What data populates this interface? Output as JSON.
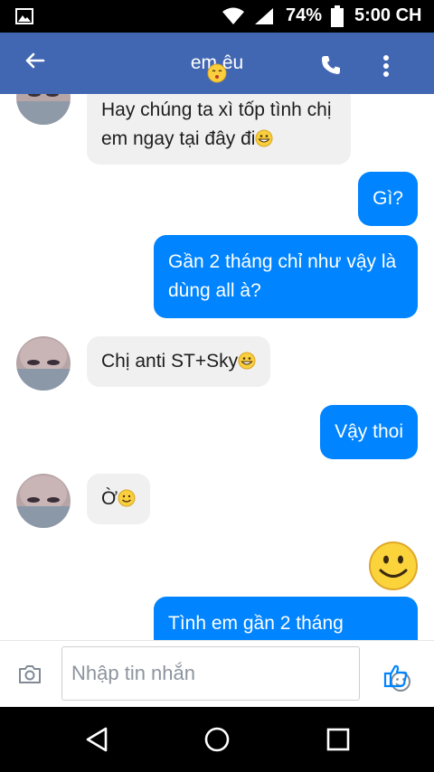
{
  "status_bar": {
    "battery_percent": "74%",
    "time": "5:00 CH"
  },
  "header": {
    "title": "em êu",
    "title_emoji": "kissing-face-icon"
  },
  "messages": [
    {
      "side": "in",
      "text": "Hay chúng ta xì tốp tình chị em ngay tại đây đi",
      "emoji": "grinning-face-icon"
    },
    {
      "side": "out",
      "text": "Gì?"
    },
    {
      "side": "out",
      "text": "Gần 2 tháng chỉ như vậy là dùng all à?"
    },
    {
      "side": "in",
      "text": "Chị anti ST+Sky",
      "emoji": "grinning-face-icon"
    },
    {
      "side": "out",
      "text": "Vậy thoi"
    },
    {
      "side": "in",
      "text": "Ờ",
      "emoji": "smiling-face-icon"
    },
    {
      "side": "out",
      "emoji": "large-smiley-icon"
    },
    {
      "side": "out",
      "text": "Tình em gần 2 tháng"
    }
  ],
  "composer": {
    "placeholder": "Nhập tin nhắn"
  },
  "colors": {
    "header": "#4267b2",
    "outgoing": "#0084ff",
    "incoming": "#f1f0f0"
  }
}
